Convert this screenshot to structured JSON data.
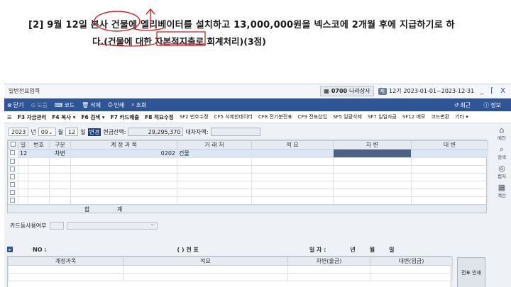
{
  "question": {
    "line1": "[2] 9월 12일 본사 건물에 엘리베이터를 설치하고 13,000,000원을 넥스코에 2개월 후에 지급하기로 하",
    "line2": "다.(건물에 대한 자본적지출로 회계처리)(3점)"
  },
  "window": {
    "title": "일반전표입력",
    "company_code": "0700",
    "company_name": "나라상사",
    "period_badge": "제",
    "period_no": "12기",
    "period_range": "2023-01-01~2023-12-31"
  },
  "toolbar1": {
    "close": "닫기",
    "disabled1": "도움",
    "code": "코드",
    "delete": "삭제",
    "print": "인쇄",
    "lookup": "조회",
    "recent": "최근",
    "info": "정보"
  },
  "toolbar2": [
    "F3 자금관리",
    "F4 복사 ▾",
    "F6 검색 ▾",
    "F7 카드매출",
    "F8 적요수정",
    "SF2 번호수정",
    "CF5 삭제한데이터",
    "CF8 전기분전표",
    "CF9 전표삽입",
    "SF5 일괄삭제",
    "SF7 일일자금",
    "SF12 메모",
    "코드변환",
    "기타 ▾"
  ],
  "filter": {
    "year": "2023",
    "year_label": "년",
    "month": "09",
    "month_label": "월",
    "day": "12",
    "day_label": "일",
    "change_label": "변경",
    "cash_label": "현금잔액:",
    "cash_value": "29,295,370",
    "diff_label": "대차차액:"
  },
  "grid": {
    "headers": [
      "일",
      "번호",
      "구분",
      "계 정 과 목",
      "거 래 처",
      "적 요",
      "차 변",
      "대 변"
    ],
    "row1": {
      "day": "12",
      "type": "차변",
      "account_code": "0202",
      "account_name": "건물"
    },
    "total_label": "합 계"
  },
  "card": {
    "label": "카드등사용여부"
  },
  "slip": {
    "no_label": "NO :",
    "title": "(        ) 전 표",
    "date_label": "일 자 :",
    "date_year": "년",
    "date_month": "월",
    "date_day": "일",
    "headers": [
      "계정과목",
      "적요",
      "차변(출금)",
      "대변(입금)"
    ],
    "print_btn": "전표 인쇄"
  },
  "side": [
    "메인",
    "검색",
    "캡처",
    "계산"
  ]
}
